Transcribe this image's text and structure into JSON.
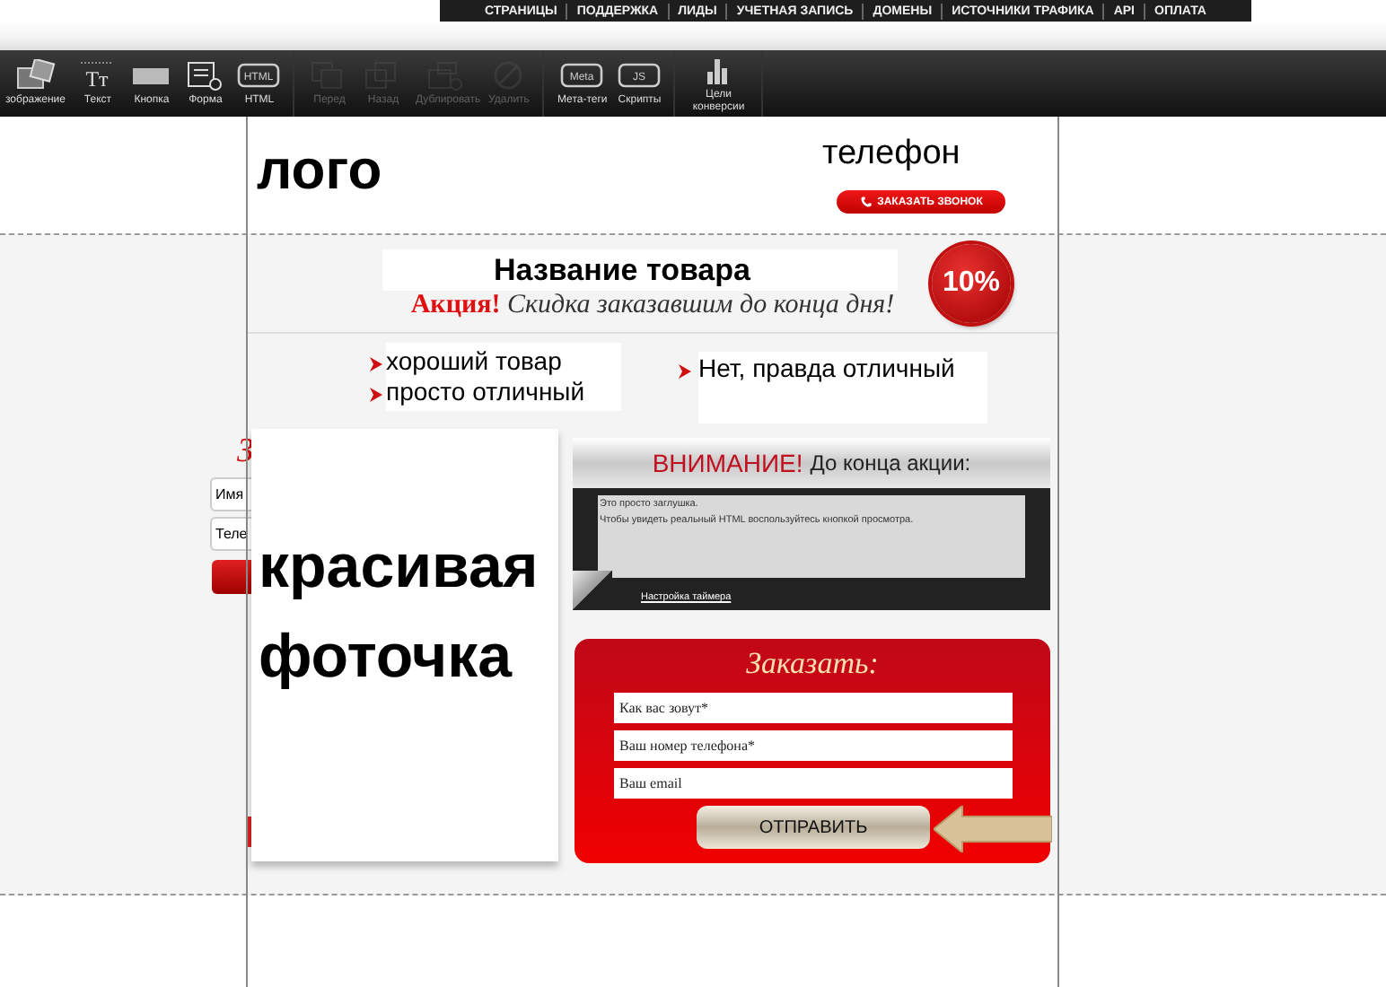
{
  "top_nav": {
    "items": [
      "СТРАНИЦЫ",
      "ПОДДЕРЖКА",
      "ЛИДЫ",
      "УЧЕТНАЯ ЗАПИСЬ",
      "ДОМЕНЫ",
      "ИСТОЧНИКИ ТРАФИКА",
      "API",
      "ОПЛАТА"
    ]
  },
  "toolbar": {
    "groups": [
      [
        {
          "kind": "image",
          "label": "зображение",
          "disabled": false
        },
        {
          "kind": "text",
          "label": "Текст",
          "icon_text": "Tт",
          "disabled": false
        },
        {
          "kind": "button",
          "label": "Кнопка",
          "disabled": false
        },
        {
          "kind": "form",
          "label": "Форма",
          "disabled": false
        },
        {
          "kind": "html",
          "label": "HTML",
          "icon_text": "HTML",
          "disabled": false
        }
      ],
      [
        {
          "kind": "front",
          "label": "Перед",
          "disabled": true
        },
        {
          "kind": "back",
          "label": "Назад",
          "disabled": true
        },
        {
          "kind": "duplicate",
          "label": "Дублировать",
          "disabled": true
        },
        {
          "kind": "delete",
          "label": "Удалить",
          "disabled": true
        }
      ],
      [
        {
          "kind": "meta",
          "label": "Мета-теги",
          "icon_text": "Meta",
          "disabled": false
        },
        {
          "kind": "js",
          "label": "Скрипты",
          "icon_text": "JS",
          "disabled": false
        }
      ],
      [
        {
          "kind": "chart",
          "label": "Цели конверсии",
          "disabled": false
        }
      ]
    ]
  },
  "header": {
    "logo": "лого",
    "phone": "телефон",
    "callback_button": "ЗАКАЗАТЬ ЗВОНОК"
  },
  "offer": {
    "title": "Название товара",
    "promo": "**Акция!** *Скидка заказавшим до конца дня!*",
    "badge": "10%"
  },
  "bullets": [
    [
      "хороший товар",
      "просто отличный"
    ],
    [
      "Нет, правда отличный"
    ]
  ],
  "hidden_form": {
    "title": "З",
    "fields": [
      "Имя",
      "Теле"
    ]
  },
  "photo": {
    "caption": "красивая фоточка"
  },
  "timer": {
    "warning": "ВНИМАНИЕ!",
    "heading": "До конца акции:",
    "lines": [
      "Это просто заглушка.",
      "Чтобы увидеть реальный HTML воспользуйтесь кнопкой просмотра."
    ],
    "link": "Настройка таймера"
  },
  "order_form": {
    "title": "Заказать:",
    "fields": [
      {
        "placeholder": "Как вас зовут*"
      },
      {
        "placeholder": "Ваш номер телефона*"
      },
      {
        "placeholder": "Ваш email"
      }
    ],
    "submit": "ОТПРАВИТЬ"
  }
}
